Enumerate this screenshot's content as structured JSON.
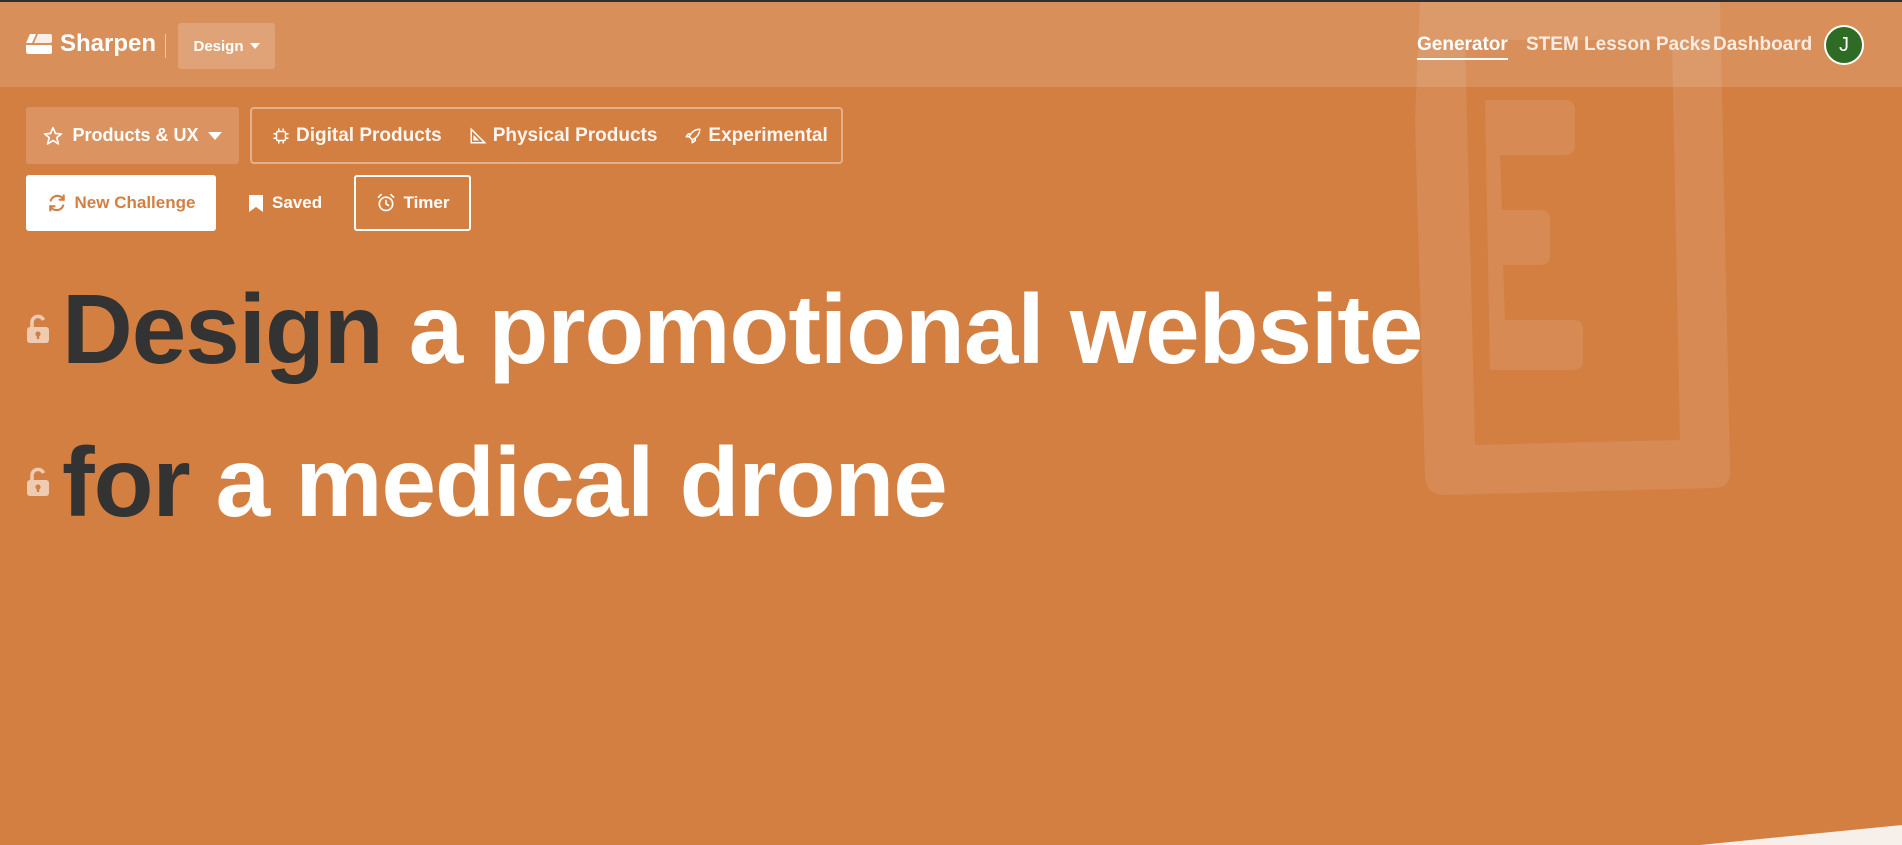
{
  "app": {
    "name": "Sharpen",
    "mode_dropdown": "Design",
    "nav": [
      "Generator",
      "STEM Lesson Packs",
      "Dashboard"
    ],
    "active_nav": "Generator",
    "avatar_initial": "J"
  },
  "colors": {
    "background": "#d47f42",
    "headline_dark": "#333333",
    "avatar": "#2e6b25"
  },
  "filters": {
    "category_dropdown": "Products & UX",
    "subcategories": [
      {
        "label": "Digital Products",
        "icon": "chip-icon"
      },
      {
        "label": "Physical Products",
        "icon": "ruler-triangle-icon"
      },
      {
        "label": "Experimental",
        "icon": "rocket-icon"
      }
    ]
  },
  "actions": {
    "new_challenge": "New Challenge",
    "saved": "Saved",
    "timer": "Timer"
  },
  "challenge": {
    "line1": {
      "lead": "Design",
      "rest": "a promotional website"
    },
    "line2": {
      "lead": "for",
      "rest": "a medical drone"
    }
  }
}
